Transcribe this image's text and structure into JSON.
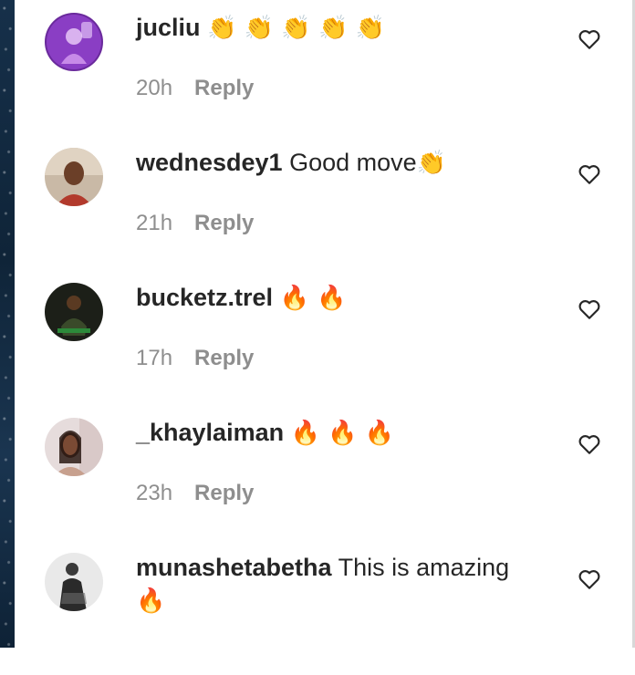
{
  "comments": [
    {
      "username": "jucliu",
      "text": "",
      "emoji": "👏 👏 👏 👏 👏",
      "time": "20h",
      "reply": "Reply"
    },
    {
      "username": "wednesdey1",
      "text": " Good move",
      "emoji": "👏",
      "time": "21h",
      "reply": "Reply"
    },
    {
      "username": "bucketz.trel",
      "text": "",
      "emoji": "🔥 🔥",
      "time": "17h",
      "reply": "Reply"
    },
    {
      "username": "_khaylaiman",
      "text": "",
      "emoji": "🔥 🔥 🔥",
      "time": "23h",
      "reply": "Reply"
    },
    {
      "username": "munashetabetha",
      "text": " This is amazing",
      "emoji": "🔥",
      "time": "",
      "reply": ""
    }
  ],
  "icons": {
    "heart": "heart-outline-icon"
  },
  "colors": {
    "text": "#262626",
    "meta": "#8e8e8e"
  }
}
